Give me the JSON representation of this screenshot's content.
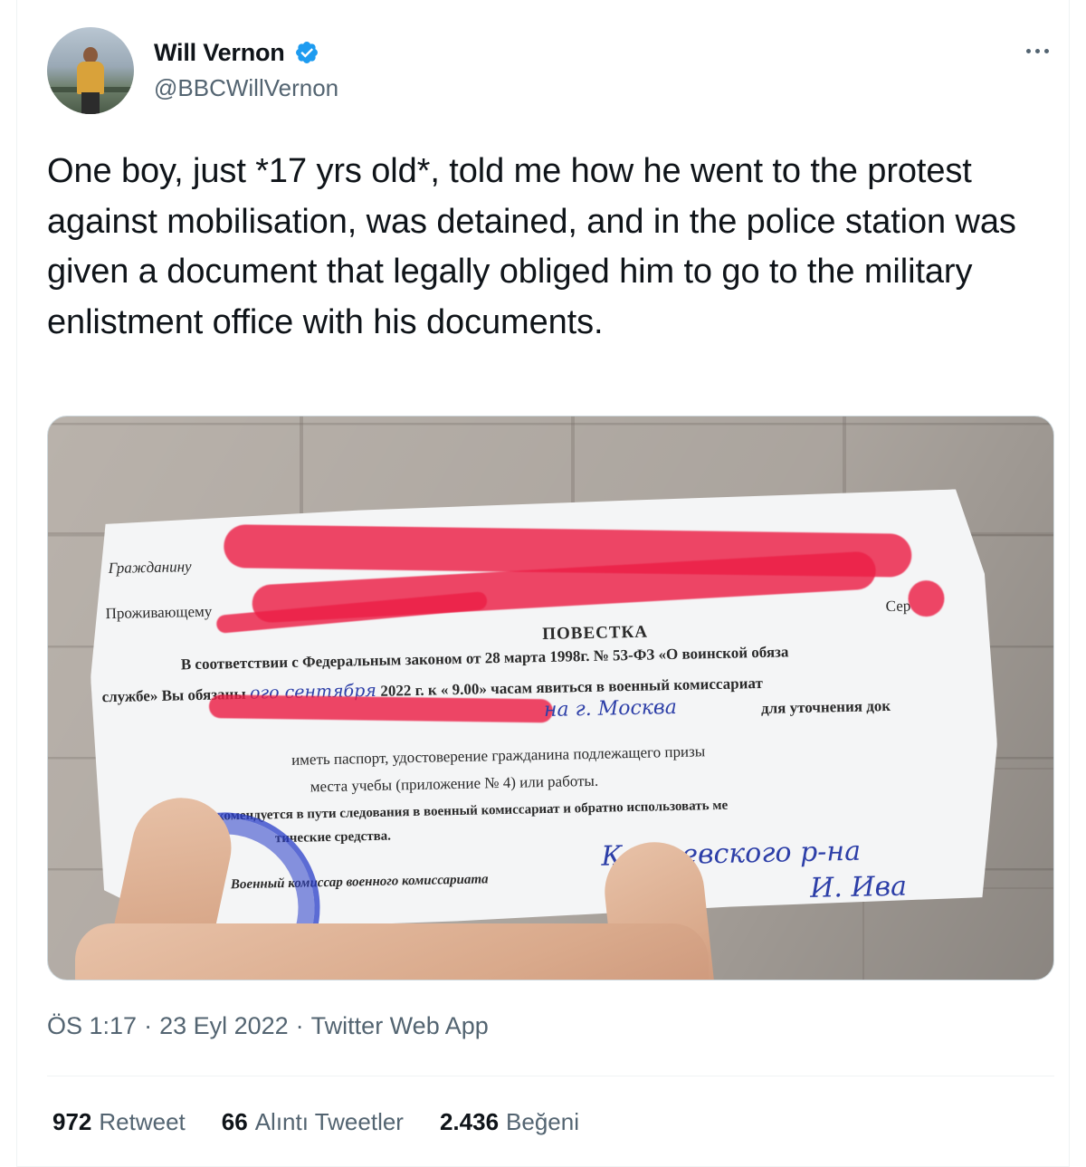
{
  "author": {
    "display_name": "Will Vernon",
    "handle": "@BBCWillVernon",
    "verified": true,
    "avatar_icon": "profile-photo"
  },
  "tweet": {
    "text": "One boy, just *17 yrs old*, told me how he went to the protest against mobilisation, was detained, and in the police station was given a document that legally obliged him to go to the military enlistment office with his documents."
  },
  "media": {
    "document": {
      "line1_label": "Гражданину",
      "line2_label": "Проживающему",
      "corner_label": "Сер",
      "title": "ПОВЕСТКА",
      "para1": "В соответствии с Федеральным законом от 28 марта 1998г. № 53-ФЗ «О воинской обяза",
      "para2_start": "службе» Вы обязаны",
      "para2_hand": "ого сентября",
      "para2_end": "2022 г. к « 9.00» часам явиться в военный комиссариат",
      "para3_hand": "на г. Москва",
      "para3_end": "для уточнения док",
      "para4": "иметь паспорт, удостоверение гражданина подлежащего призы",
      "para5": "места учебы (приложение № 4) или работы.",
      "para6": "Рекомендуется в пути следования в военный комиссариат и обратно использовать ме",
      "para7": "тические средства.",
      "signature_label": "Военный комиссар военного комиссариата",
      "signature_hand1": "Кортевского р-на",
      "signature_hand2": "И. Ива"
    }
  },
  "meta": {
    "time": "ÖS 1:17",
    "date": "23 Eyl 2022",
    "separator": "·",
    "source": "Twitter Web App"
  },
  "stats": {
    "retweets": {
      "value": "972",
      "label": "Retweet"
    },
    "quotes": {
      "value": "66",
      "label": "Alıntı Tweetler"
    },
    "likes": {
      "value": "2.436",
      "label": "Beğeni"
    }
  },
  "colors": {
    "text_primary": "#0f1419",
    "text_secondary": "#536471",
    "verified_blue": "#1d9bf0",
    "divider": "#eff3f4",
    "redaction": "#eb1e46"
  }
}
